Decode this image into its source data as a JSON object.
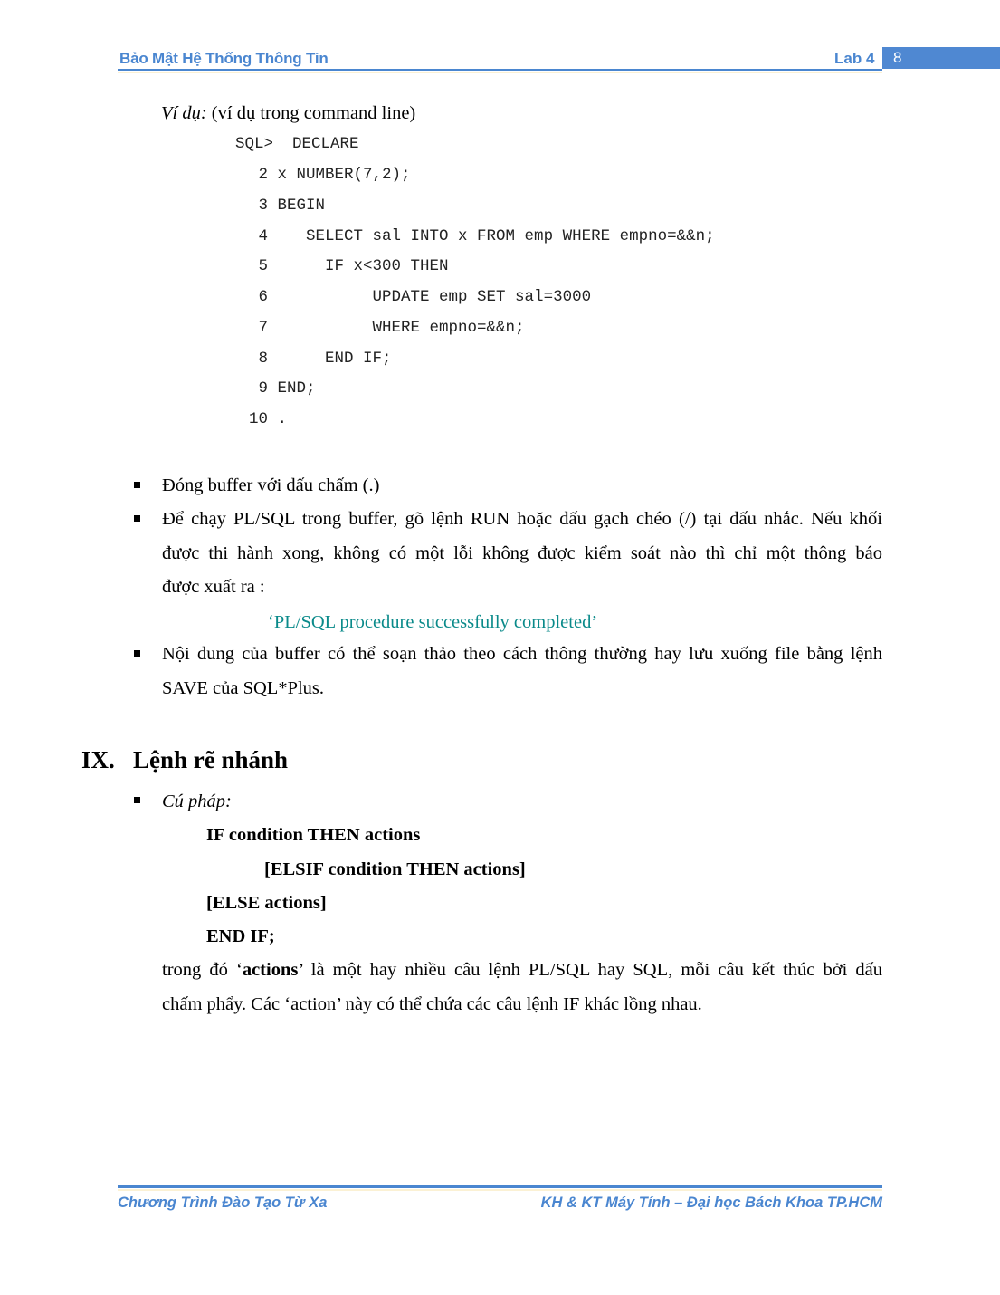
{
  "header": {
    "title": "Bảo Mật Hệ Thống Thông Tin",
    "lab": "Lab 4",
    "page_number": "8",
    "accent_color": "#4a86d0"
  },
  "example": {
    "label_italic": "Ví dụ:",
    "label_rest": " (ví dụ trong command line)",
    "code_lines": [
      {
        "num": "SQL>",
        "text": "DECLARE"
      },
      {
        "num": "2",
        "text": "x NUMBER(7,2);"
      },
      {
        "num": "3",
        "text": "BEGIN"
      },
      {
        "num": "4",
        "text": "   SELECT sal INTO x FROM emp WHERE empno=&&n;"
      },
      {
        "num": "5",
        "text": "     IF x<300 THEN"
      },
      {
        "num": "6",
        "text": "          UPDATE emp SET sal=3000"
      },
      {
        "num": "7",
        "text": "          WHERE empno=&&n;"
      },
      {
        "num": "8",
        "text": "     END IF;"
      },
      {
        "num": "9",
        "text": "END;"
      },
      {
        "num": "10",
        "text": "."
      }
    ]
  },
  "bullets": [
    {
      "lines": [
        "Đóng buffer với dấu chấm (.)"
      ]
    },
    {
      "lines": [
        "Để chạy PL/SQL trong buffer, gõ lệnh RUN hoặc dấu gạch chéo (/) tại dấu nhắc. Nếu khối",
        "được thi hành xong, không có một lỗi không được kiểm soát nào thì chỉ một thông báo",
        "được xuất ra :"
      ]
    },
    {
      "lines": [
        "Nội dung của buffer có thể soạn thảo theo cách thông thường hay lưu xuống file bằng lệnh",
        "SAVE của SQL*Plus."
      ]
    }
  ],
  "success_message": "‘PL/SQL procedure successfully completed’",
  "section": {
    "number": "IX.",
    "title": "Lệnh rẽ nhánh",
    "syntax_label": "Cú pháp:",
    "syntax_lines": [
      "IF condition THEN actions",
      "[ELSIF condition THEN actions]",
      "[ELSE actions]",
      "END IF;"
    ],
    "description": {
      "line1_pre": "trong đó ‘",
      "line1_bold": "actions",
      "line1_post": "’ là một hay nhiều câu lệnh PL/SQL hay SQL, mỗi câu kết thúc bởi dấu",
      "line2": "chấm phẩy. Các ‘action’ này có thể chứa các câu lệnh IF khác lồng nhau."
    }
  },
  "footer": {
    "left": "Chương Trình Đào Tạo Từ Xa",
    "right": "KH & KT Máy Tính – Đại học Bách Khoa TP.HCM"
  }
}
